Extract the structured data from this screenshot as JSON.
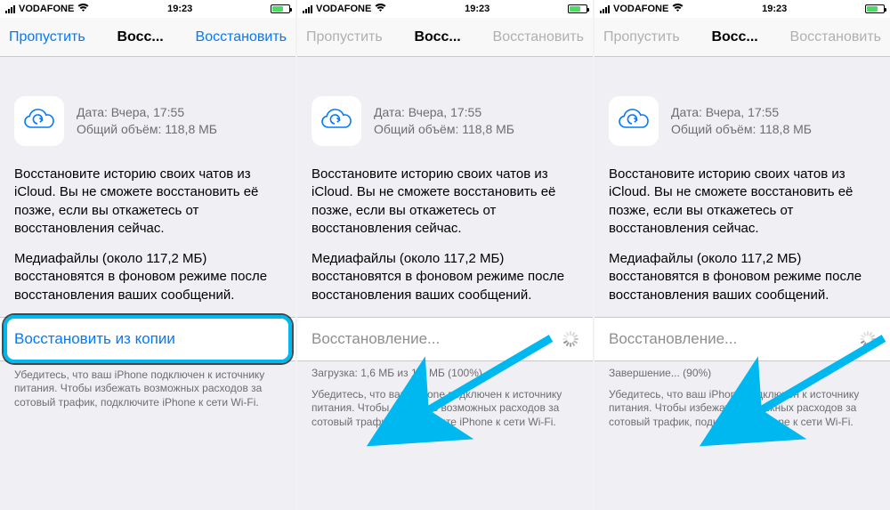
{
  "status": {
    "carrier": "VODAFONE",
    "time": "19:23"
  },
  "nav": {
    "skip": "Пропустить",
    "title": "Восс...",
    "restore": "Восстановить"
  },
  "backup": {
    "date_label": "Дата: Вчера, 17:55",
    "size_label": "Общий объём: 118,8 МБ"
  },
  "body": {
    "p1": "Восстановите историю своих чатов из iCloud. Вы не сможете восстановить её позже, если вы откажетесь от восстановления сейчас.",
    "p2": "Медиафайлы (около 117,2 МБ) восстановятся в фоновом режиме после восстановления ваших сообщений."
  },
  "screens": [
    {
      "restore_label": "Восстановить из копии",
      "progress_text": "",
      "footer": "Убедитесь, что ваш iPhone подключен к источнику питания. Чтобы избежать возможных расходов за сотовый трафик, подключите iPhone к сети Wi-Fi.",
      "nav_disabled": false,
      "highlighted": true,
      "spinner": false
    },
    {
      "restore_label": "Восстановление...",
      "progress_text": "Загрузка: 1,6 МБ из 1,6 МБ (100%)",
      "footer": "Убедитесь, что ваш iPhone подключен к источнику питания. Чтобы избежать возможных расходов за сотовый трафик, подключите iPhone к сети Wi-Fi.",
      "nav_disabled": true,
      "highlighted": false,
      "spinner": true
    },
    {
      "restore_label": "Восстановление...",
      "progress_text": "Завершение... (90%)",
      "footer": "Убедитесь, что ваш iPhone подключен к источнику питания. Чтобы избежать возможных расходов за сотовый трафик, подключите iPhone к сети Wi-Fi.",
      "nav_disabled": true,
      "highlighted": false,
      "spinner": true
    }
  ],
  "colors": {
    "ios_blue": "#007aff",
    "annotation_blue": "#00b8f0"
  }
}
